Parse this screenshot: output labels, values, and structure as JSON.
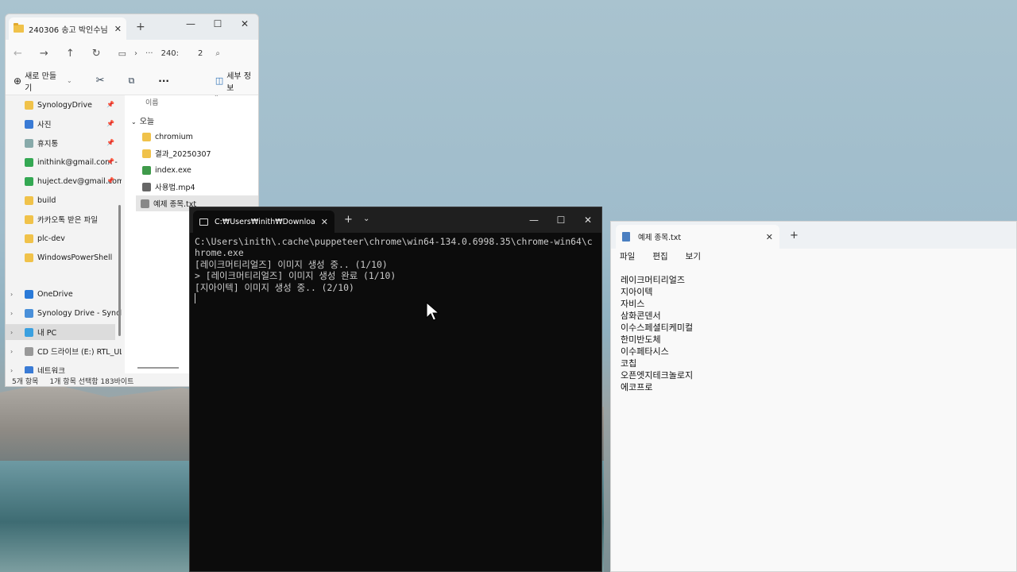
{
  "explorer": {
    "tab_title": "240306 송고 박인수님",
    "address_fragment": "240:",
    "address_trail": "2",
    "toolbar": {
      "new_label": "새로 만들기",
      "details_label": "세부 정보"
    },
    "column_header": "이름",
    "group_today": "오늘",
    "sidebar": [
      {
        "label": "SynologyDrive",
        "pinned": true,
        "icon": "folder-icon",
        "color": "#f0c24a"
      },
      {
        "label": "사진",
        "pinned": true,
        "icon": "pictures-icon",
        "color": "#3a7bd5"
      },
      {
        "label": "휴지통",
        "pinned": true,
        "icon": "recycle-bin-icon",
        "color": "#8aa"
      },
      {
        "label": "inithink@gmail.com -",
        "pinned": true,
        "icon": "google-drive-icon",
        "color": "#34a853"
      },
      {
        "label": "huject.dev@gmail.com",
        "pinned": true,
        "icon": "google-drive-icon",
        "color": "#34a853"
      },
      {
        "label": "build",
        "pinned": false,
        "icon": "folder-icon",
        "color": "#f0c24a"
      },
      {
        "label": "카카오톡 받은 파일",
        "pinned": false,
        "icon": "folder-icon",
        "color": "#f0c24a"
      },
      {
        "label": "plc-dev",
        "pinned": false,
        "icon": "folder-icon",
        "color": "#f0c24a"
      },
      {
        "label": "WindowsPowerShell",
        "pinned": false,
        "icon": "folder-icon",
        "color": "#f0c24a"
      }
    ],
    "sidebar_roots": [
      {
        "label": "OneDrive",
        "icon": "onedrive-icon",
        "color": "#2a7ad8",
        "selected": false
      },
      {
        "label": "Synology Drive - Synolo",
        "icon": "synology-icon",
        "color": "#4a90d9",
        "selected": false
      },
      {
        "label": "내 PC",
        "icon": "pc-icon",
        "color": "#3aa0e0",
        "selected": true
      },
      {
        "label": "CD 드라이브 (E:) RTL_UL",
        "icon": "cd-drive-icon",
        "color": "#999",
        "selected": false
      },
      {
        "label": "네트워크",
        "icon": "network-icon",
        "color": "#3a7bd5",
        "selected": false
      }
    ],
    "files": [
      {
        "name": "chromium",
        "icon": "folder-icon",
        "color": "#f0c24a",
        "selected": false
      },
      {
        "name": "결과_20250307",
        "icon": "folder-icon",
        "color": "#f0c24a",
        "selected": false
      },
      {
        "name": "index.exe",
        "icon": "exe-icon",
        "color": "#3f9a4a",
        "selected": false
      },
      {
        "name": "사용법.mp4",
        "icon": "video-file-icon",
        "color": "#666",
        "selected": false
      },
      {
        "name": "예제 종목.txt",
        "icon": "text-file-icon",
        "color": "#888",
        "selected": true
      }
    ],
    "status": {
      "count": "5개 항목",
      "selection": "1개 항목 선택함 183바이트"
    }
  },
  "terminal": {
    "tab_title": "C:₩Users₩inith₩Downloads₩",
    "lines": [
      "C:\\Users\\inith\\.cache\\puppeteer\\chrome\\win64-134.0.6998.35\\chrome-win64\\chrome.exe",
      "[레이크머티리얼즈] 이미지 생성 중.. (1/10)",
      "> [레이크머티리얼즈] 이미지 생성 완료 (1/10)",
      "[지아이텍] 이미지 생성 중.. (2/10)"
    ]
  },
  "notepad": {
    "tab_title": "예제 종목.txt",
    "menu": [
      "파일",
      "편집",
      "보기"
    ],
    "lines": [
      "레이크머티리얼즈",
      "지아이텍",
      "자비스",
      "삼화콘덴서",
      "이수스페셜티케미컬",
      "한미반도체",
      "이수페타시스",
      "코칩",
      "오픈엣지테크놀로지",
      "에코프로"
    ]
  }
}
